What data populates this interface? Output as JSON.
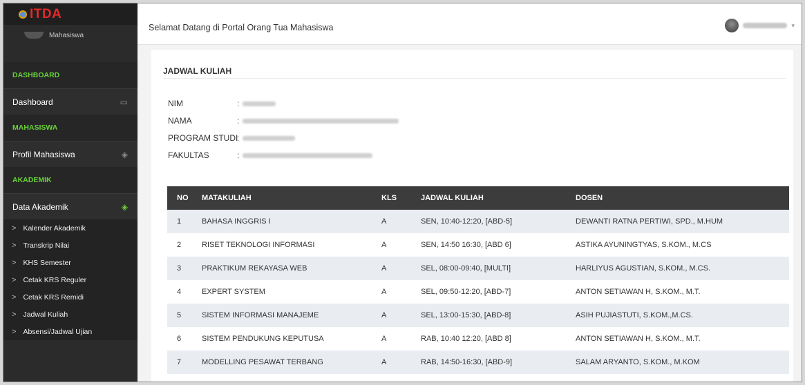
{
  "brand": {
    "name": "ITDA"
  },
  "sidebar": {
    "role": "Mahasiswa",
    "sections": {
      "dashboard": "DASHBOARD",
      "mahasiswa": "MAHASISWA",
      "akademik": "AKADEMIK"
    },
    "items": {
      "dashboard": "Dashboard",
      "profil": "Profil Mahasiswa",
      "data_akademik": "Data Akademik"
    },
    "submenu": [
      "Kalender Akademik",
      "Transkrip Nilai",
      "KHS Semester",
      "Cetak KRS Reguler",
      "Cetak KRS Remidi",
      "Jadwal Kuliah",
      "Absensi/Jadwal Ujian"
    ]
  },
  "header": {
    "welcome": "Selamat Datang di Portal Orang Tua Mahasiswa"
  },
  "page": {
    "title": "JADWAL KULIAH",
    "fields": [
      {
        "label": "NIM"
      },
      {
        "label": "NAMA"
      },
      {
        "label": "PROGRAM STUDI"
      },
      {
        "label": "FAKULTAS"
      }
    ],
    "colon": ":"
  },
  "table": {
    "headers": [
      "NO",
      "MATAKULIAH",
      "KLS",
      "JADWAL KULIAH",
      "DOSEN"
    ],
    "rows": [
      [
        "1",
        "BAHASA INGGRIS I",
        "A",
        "SEN, 10:40-12:20, [ABD-5]",
        "DEWANTI RATNA PERTIWI, SPD., M.HUM"
      ],
      [
        "2",
        "RISET TEKNOLOGI INFORMASI",
        "A",
        "SEN, 14:50 16:30, [ABD 6]",
        "ASTIKA AYUNINGTYAS, S.KOM., M.CS"
      ],
      [
        "3",
        "PRAKTIKUM REKAYASA WEB",
        "A",
        "SEL, 08:00-09:40, [MULTI]",
        "HARLIYUS AGUSTIAN, S.KOM., M.CS."
      ],
      [
        "4",
        "EXPERT SYSTEM",
        "A",
        "SEL, 09:50-12:20, [ABD-7]",
        "ANTON SETIAWAN H, S.KOM., M.T."
      ],
      [
        "5",
        "SISTEM INFORMASI MANAJEME",
        "A",
        "SEL, 13:00-15:30, [ABD-8]",
        "ASIH PUJIASTUTI, S.KOM.,M.CS."
      ],
      [
        "6",
        "SISTEM PENDUKUNG KEPUTUSA",
        "A",
        "RAB, 10:40 12:20, [ABD 8]",
        "ANTON SETIAWAN H, S.KOM., M.T."
      ],
      [
        "7",
        "MODELLING PESAWAT TERBANG",
        "A",
        "RAB, 14:50-16:30, [ABD-9]",
        "SALAM ARYANTO, S.KOM., M.KOM"
      ]
    ]
  },
  "colors": {
    "accent": "#67d13a",
    "sidebar": "#2b2b2b",
    "brand": "#e62828"
  }
}
